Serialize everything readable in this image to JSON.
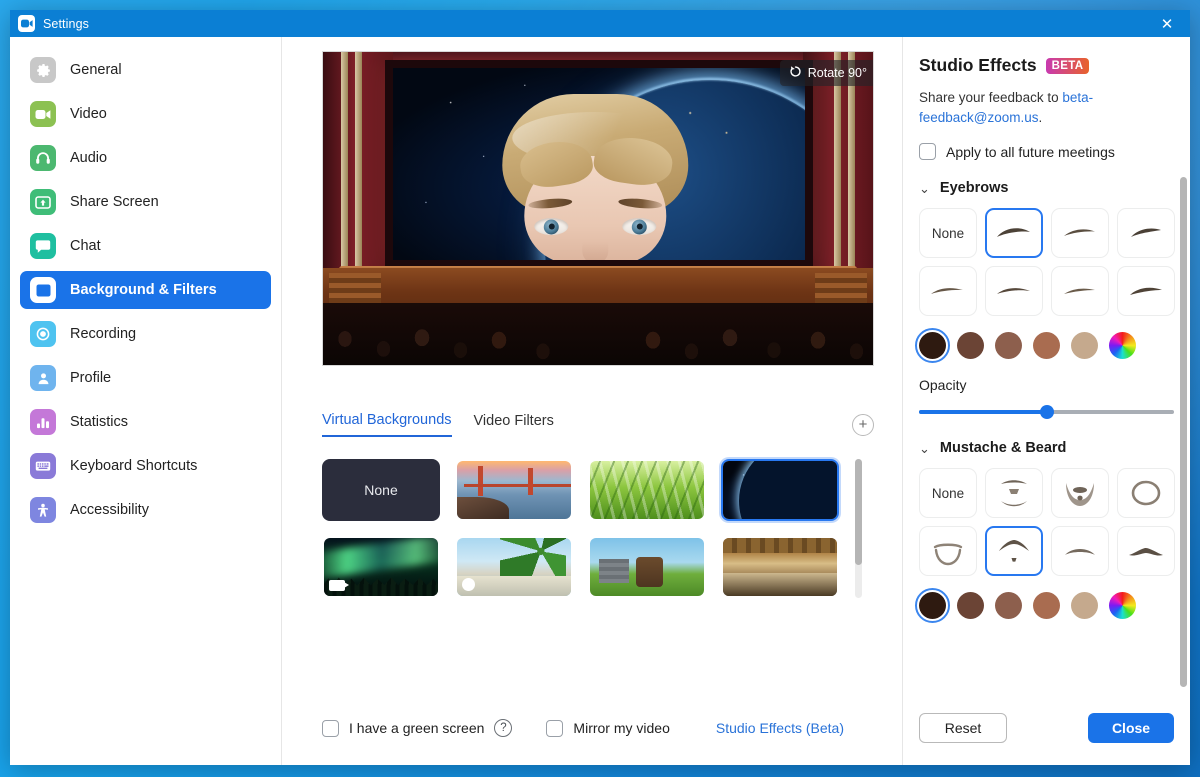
{
  "window": {
    "title": "Settings",
    "titlebar_color": "#0b7fd4",
    "close_label": "✕"
  },
  "sidebar": {
    "items": [
      {
        "label": "General",
        "icon": "gear-icon",
        "color": "#c8c8c8",
        "active": false
      },
      {
        "label": "Video",
        "icon": "video-camera-icon",
        "color": "#8cc152",
        "active": false
      },
      {
        "label": "Audio",
        "icon": "headphones-icon",
        "color": "#4cb870",
        "active": false
      },
      {
        "label": "Share Screen",
        "icon": "share-screen-icon",
        "color": "#3fbd78",
        "active": false
      },
      {
        "label": "Chat",
        "icon": "chat-bubble-icon",
        "color": "#1fbfa0",
        "active": false
      },
      {
        "label": "Background & Filters",
        "icon": "person-card-icon",
        "color": "#1a73e8",
        "active": true
      },
      {
        "label": "Recording",
        "icon": "record-circle-icon",
        "color": "#4ec3f0",
        "active": false
      },
      {
        "label": "Profile",
        "icon": "person-icon",
        "color": "#6fb4ee",
        "active": false
      },
      {
        "label": "Statistics",
        "icon": "bar-chart-icon",
        "color": "#c478d8",
        "active": false
      },
      {
        "label": "Keyboard Shortcuts",
        "icon": "keyboard-icon",
        "color": "#8a7ad8",
        "active": false
      },
      {
        "label": "Accessibility",
        "icon": "accessibility-icon",
        "color": "#7e86e0",
        "active": false
      }
    ]
  },
  "preview": {
    "rotate_label": "Rotate 90°",
    "rotate_icon": "rotate-icon"
  },
  "tabs": {
    "items": [
      {
        "label": "Virtual Backgrounds",
        "active": true
      },
      {
        "label": "Video Filters",
        "active": false
      }
    ],
    "add_label": "+"
  },
  "backgrounds": {
    "items": [
      {
        "label": "None",
        "kind": "none",
        "selected": false,
        "downloaded": false
      },
      {
        "label": "Golden Gate Bridge",
        "kind": "bridge",
        "selected": false,
        "downloaded": false
      },
      {
        "label": "Grass",
        "kind": "grass",
        "selected": false,
        "downloaded": false
      },
      {
        "label": "Earth from Space",
        "kind": "space",
        "selected": true,
        "downloaded": false
      },
      {
        "label": "Aurora Borealis",
        "kind": "aurora",
        "selected": false,
        "downloaded": true
      },
      {
        "label": "Beach",
        "kind": "beach",
        "selected": false,
        "downloaded": true
      },
      {
        "label": "Minecraft",
        "kind": "minecraft",
        "selected": false,
        "downloaded": false
      },
      {
        "label": "Hotel Lobby",
        "kind": "lobby",
        "selected": false,
        "downloaded": false
      }
    ]
  },
  "bottom_bar": {
    "green_screen_label": "I have a green screen",
    "green_screen_checked": false,
    "help_glyph": "?",
    "mirror_label": "Mirror my video",
    "mirror_checked": false,
    "studio_effects_link": "Studio Effects (Beta)"
  },
  "studio_effects": {
    "title": "Studio Effects",
    "badge": "BETA",
    "feedback_prefix": "Share your feedback to ",
    "feedback_email": "beta-feedback@zoom.us",
    "feedback_suffix": ".",
    "apply_all_label": "Apply to all future meetings",
    "apply_all_checked": false,
    "chevron": "⌄",
    "eyebrows": {
      "title": "Eyebrows",
      "options": [
        {
          "label": "None",
          "kind": "none",
          "selected": false
        },
        {
          "label": "Eyebrow style 1",
          "kind": "brow1",
          "selected": true
        },
        {
          "label": "Eyebrow style 2",
          "kind": "brow2",
          "selected": false
        },
        {
          "label": "Eyebrow style 3",
          "kind": "brow3",
          "selected": false
        },
        {
          "label": "Eyebrow style 4",
          "kind": "brow4",
          "selected": false
        },
        {
          "label": "Eyebrow style 5",
          "kind": "brow5",
          "selected": false
        },
        {
          "label": "Eyebrow style 6",
          "kind": "brow6",
          "selected": false
        },
        {
          "label": "Eyebrow style 7",
          "kind": "brow7",
          "selected": false
        }
      ],
      "colors": [
        {
          "hex": "#2e1a10",
          "selected": true
        },
        {
          "hex": "#6b4435",
          "selected": false
        },
        {
          "hex": "#8d5f4d",
          "selected": false
        },
        {
          "hex": "#a96c50",
          "selected": false
        },
        {
          "hex": "#c5a98d",
          "selected": false
        },
        {
          "hex": "wheel",
          "selected": false
        }
      ],
      "opacity_label": "Opacity",
      "opacity_value": 50
    },
    "mustache": {
      "title": "Mustache & Beard",
      "options": [
        {
          "label": "None",
          "kind": "none",
          "selected": false
        },
        {
          "label": "Beard style 1",
          "kind": "beard1",
          "selected": false
        },
        {
          "label": "Beard style 2",
          "kind": "beard2",
          "selected": false
        },
        {
          "label": "Beard style 3",
          "kind": "beard3",
          "selected": false
        },
        {
          "label": "Beard style 4",
          "kind": "beard4",
          "selected": false
        },
        {
          "label": "Beard style 5",
          "kind": "beard5",
          "selected": true
        },
        {
          "label": "Beard style 6",
          "kind": "beard6",
          "selected": false
        },
        {
          "label": "Beard style 7",
          "kind": "beard7",
          "selected": false
        }
      ],
      "colors": [
        {
          "hex": "#2e1a10",
          "selected": true
        },
        {
          "hex": "#6b4435",
          "selected": false
        },
        {
          "hex": "#8d5f4d",
          "selected": false
        },
        {
          "hex": "#a96c50",
          "selected": false
        },
        {
          "hex": "#c5a98d",
          "selected": false
        },
        {
          "hex": "wheel",
          "selected": false
        }
      ]
    },
    "reset_label": "Reset",
    "close_label": "Close"
  }
}
